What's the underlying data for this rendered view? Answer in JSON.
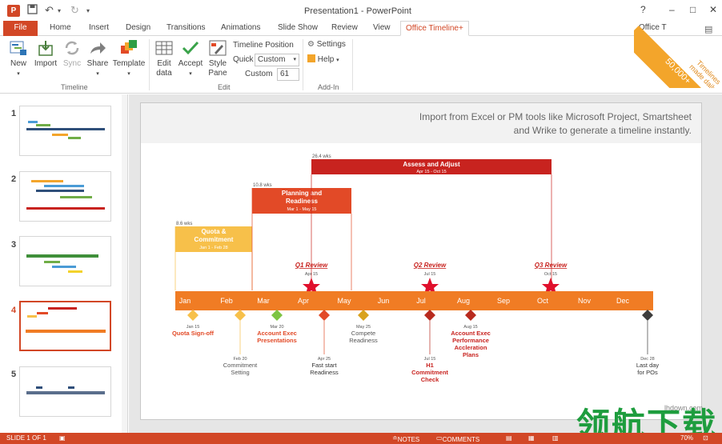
{
  "titlebar": {
    "app_icon": "P",
    "title": "Presentation1 - PowerPoint",
    "help": "?",
    "minimize": "–",
    "restore": "□",
    "close": "✕"
  },
  "tabs": [
    {
      "label": "File"
    },
    {
      "label": "Home"
    },
    {
      "label": "Insert"
    },
    {
      "label": "Design"
    },
    {
      "label": "Transitions"
    },
    {
      "label": "Animations"
    },
    {
      "label": "Slide Show"
    },
    {
      "label": "Review"
    },
    {
      "label": "View"
    },
    {
      "label": "Office Timeline+"
    }
  ],
  "account_label": "Office T",
  "promo": {
    "line1": "50,000+",
    "line2": "Timelines",
    "line3": "made daily"
  },
  "ribbon": {
    "timeline_group": {
      "label": "Timeline",
      "buttons": [
        {
          "label": "New"
        },
        {
          "label": "Import"
        },
        {
          "label": "Sync"
        },
        {
          "label": "Share"
        },
        {
          "label": "Template"
        }
      ]
    },
    "edit_group": {
      "label": "Edit",
      "edit_data_1": "Edit",
      "edit_data_2": "data",
      "accept": "Accept",
      "style_pane_1": "Style",
      "style_pane_2": "Pane",
      "timeline_position": "Timeline Position",
      "quick_label": "Quick",
      "quick_value": "Custom",
      "custom_label": "Custom",
      "custom_value": "61"
    },
    "addin_group": {
      "label": "Add-In",
      "settings": "Settings",
      "help": "Help"
    }
  },
  "slides": [
    {
      "num": "1"
    },
    {
      "num": "2"
    },
    {
      "num": "3"
    },
    {
      "num": "4"
    },
    {
      "num": "5"
    }
  ],
  "slide": {
    "header_line1": "Import from Excel or PM tools like Microsoft Project, Smartsheet",
    "header_line2": "and Wrike to generate a timeline instantly.",
    "months": [
      "Jan",
      "Feb",
      "Mar",
      "Apr",
      "May",
      "Jun",
      "Jul",
      "Aug",
      "Sep",
      "Oct",
      "Nov",
      "Dec"
    ],
    "tasks": [
      {
        "duration": "8.6 wks",
        "title1": "Quota &",
        "title2": "Commitment",
        "dates": "Jan 1 - Feb 28",
        "color": "#f7c04a"
      },
      {
        "duration": "10.8 wks",
        "title1": "Planning and",
        "title2": "Readiness",
        "dates": "Mar 1 - May 15",
        "color": "#e24a27"
      },
      {
        "duration": "26.4 wks",
        "title1": "Assess and Adjust",
        "title2": "",
        "dates": "Apr 15 - Oct 15",
        "color": "#c8231f"
      }
    ],
    "reviews": [
      {
        "name": "Q1 Review",
        "date": "Apr 15"
      },
      {
        "name": "Q2 Review",
        "date": "Jul 15"
      },
      {
        "name": "Q3 Review",
        "date": "Oct 15"
      }
    ],
    "milestones": [
      {
        "date": "Jan 15",
        "l1": "Quota Sign-off",
        "l2": "",
        "l3": "",
        "l4": ""
      },
      {
        "date": "Feb 20",
        "l1": "Commitment",
        "l2": "Setting",
        "l3": "",
        "l4": ""
      },
      {
        "date": "Mar 20",
        "l1": "Account Exec",
        "l2": "Presentations",
        "l3": "",
        "l4": ""
      },
      {
        "date": "Apr 25",
        "l1": "Fast start",
        "l2": "Readiness",
        "l3": "",
        "l4": ""
      },
      {
        "date": "May 25",
        "l1": "Compete",
        "l2": "Readiness",
        "l3": "",
        "l4": ""
      },
      {
        "date": "Jul 15",
        "l1": "H1",
        "l2": "Commitment",
        "l3": "Check",
        "l4": ""
      },
      {
        "date": "Aug 15",
        "l1": "Account Exec",
        "l2": "Performance",
        "l3": "Accleration",
        "l4": "Plans"
      },
      {
        "date": "Dec 28",
        "l1": "Last day",
        "l2": "for POs",
        "l3": "",
        "l4": ""
      }
    ]
  },
  "status": {
    "slide_of": "SLIDE 1 OF 1",
    "notes": "NOTES",
    "comments": "COMMENTS",
    "zoom": "70%"
  },
  "watermark": {
    "url": "lhdown.com",
    "cn": "领航下载"
  }
}
